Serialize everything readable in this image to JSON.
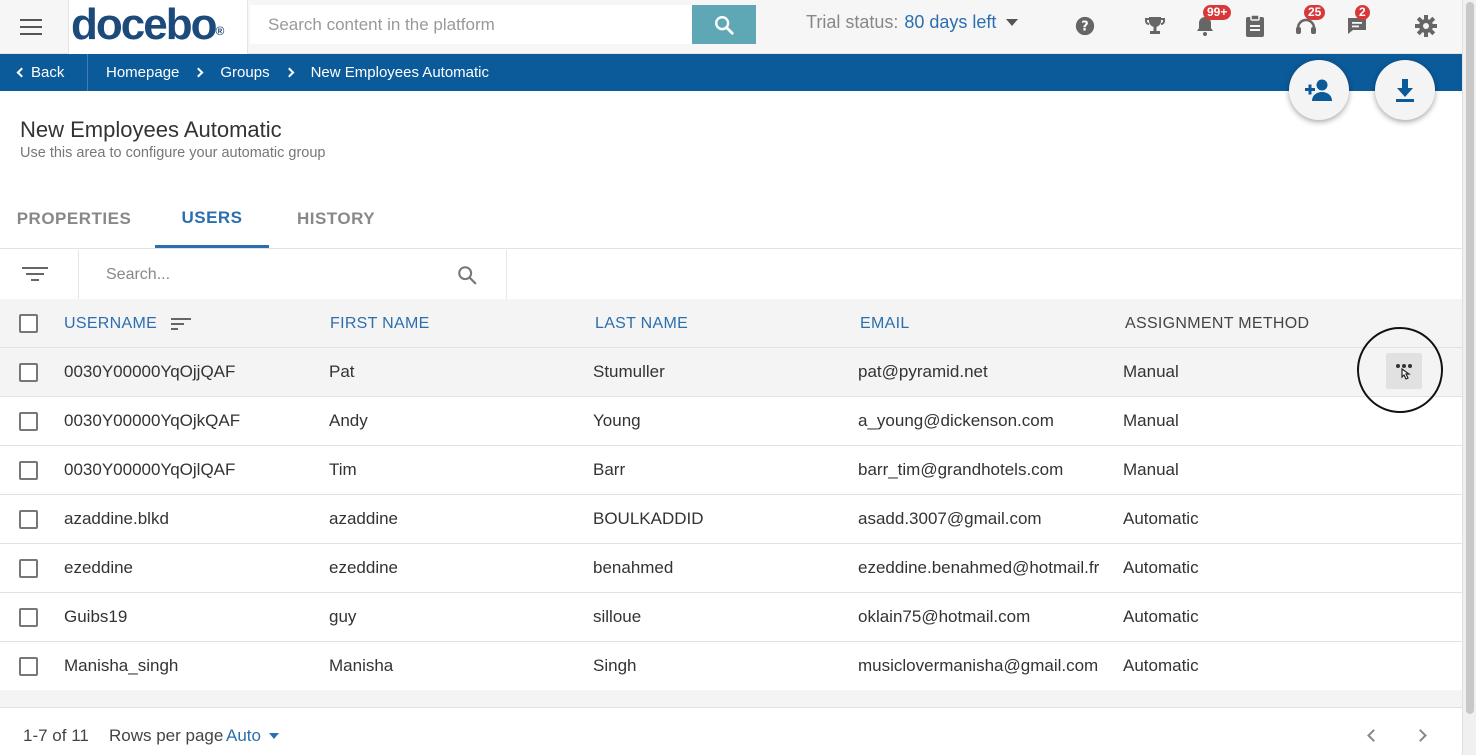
{
  "header": {
    "logo_text": "docebo",
    "logo_mark": "®",
    "search_placeholder": "Search content in the platform",
    "trial_label": "Trial status:",
    "trial_days": "80 days left",
    "badges": {
      "notifications": "99+",
      "support": "25",
      "messages": "2"
    },
    "icons": [
      "menu-icon",
      "search-icon",
      "help-icon",
      "trophy-icon",
      "bell-icon",
      "clipboard-icon",
      "headset-icon",
      "chat-icon",
      "gear-icon"
    ]
  },
  "breadcrumb": {
    "back_label": "Back",
    "items": [
      "Homepage",
      "Groups",
      "New Employees Automatic"
    ]
  },
  "page": {
    "title": "New Employees Automatic",
    "subtitle": "Use this area to configure your automatic group"
  },
  "tabs": [
    "PROPERTIES",
    "USERS",
    "HISTORY"
  ],
  "active_tab": "USERS",
  "table_search_placeholder": "Search...",
  "table": {
    "columns": [
      "USERNAME",
      "FIRST NAME",
      "LAST NAME",
      "EMAIL",
      "ASSIGNMENT METHOD"
    ],
    "rows": [
      [
        "0030Y00000YqOjjQAF",
        "Pat",
        "Stumuller",
        "pat@pyramid.net",
        "Manual"
      ],
      [
        "0030Y00000YqOjkQAF",
        "Andy",
        "Young",
        "a_young@dickenson.com",
        "Manual"
      ],
      [
        "0030Y00000YqOjlQAF",
        "Tim",
        "Barr",
        "barr_tim@grandhotels.com",
        "Manual"
      ],
      [
        "azaddine.blkd",
        "azaddine",
        "BOULKADDID",
        "asadd.3007@gmail.com",
        "Automatic"
      ],
      [
        "ezeddine",
        "ezeddine",
        "benahmed",
        "ezeddine.benahmed@hotmail.fr",
        "Automatic"
      ],
      [
        "Guibs19",
        "guy",
        "silloue",
        "oklain75@hotmail.com",
        "Automatic"
      ],
      [
        "Manisha_singh",
        "Manisha",
        "Singh",
        "musiclovermanisha@gmail.com",
        "Automatic"
      ]
    ]
  },
  "footer": {
    "range": "1-7 of 11",
    "rows_per_page_label": "Rows per page",
    "rows_per_page_value": "Auto"
  },
  "colors": {
    "brand_blue": "#0b5a9a",
    "accent": "#2c6fae",
    "search_button": "#5ea7b5",
    "badge_red": "#d9383a"
  }
}
